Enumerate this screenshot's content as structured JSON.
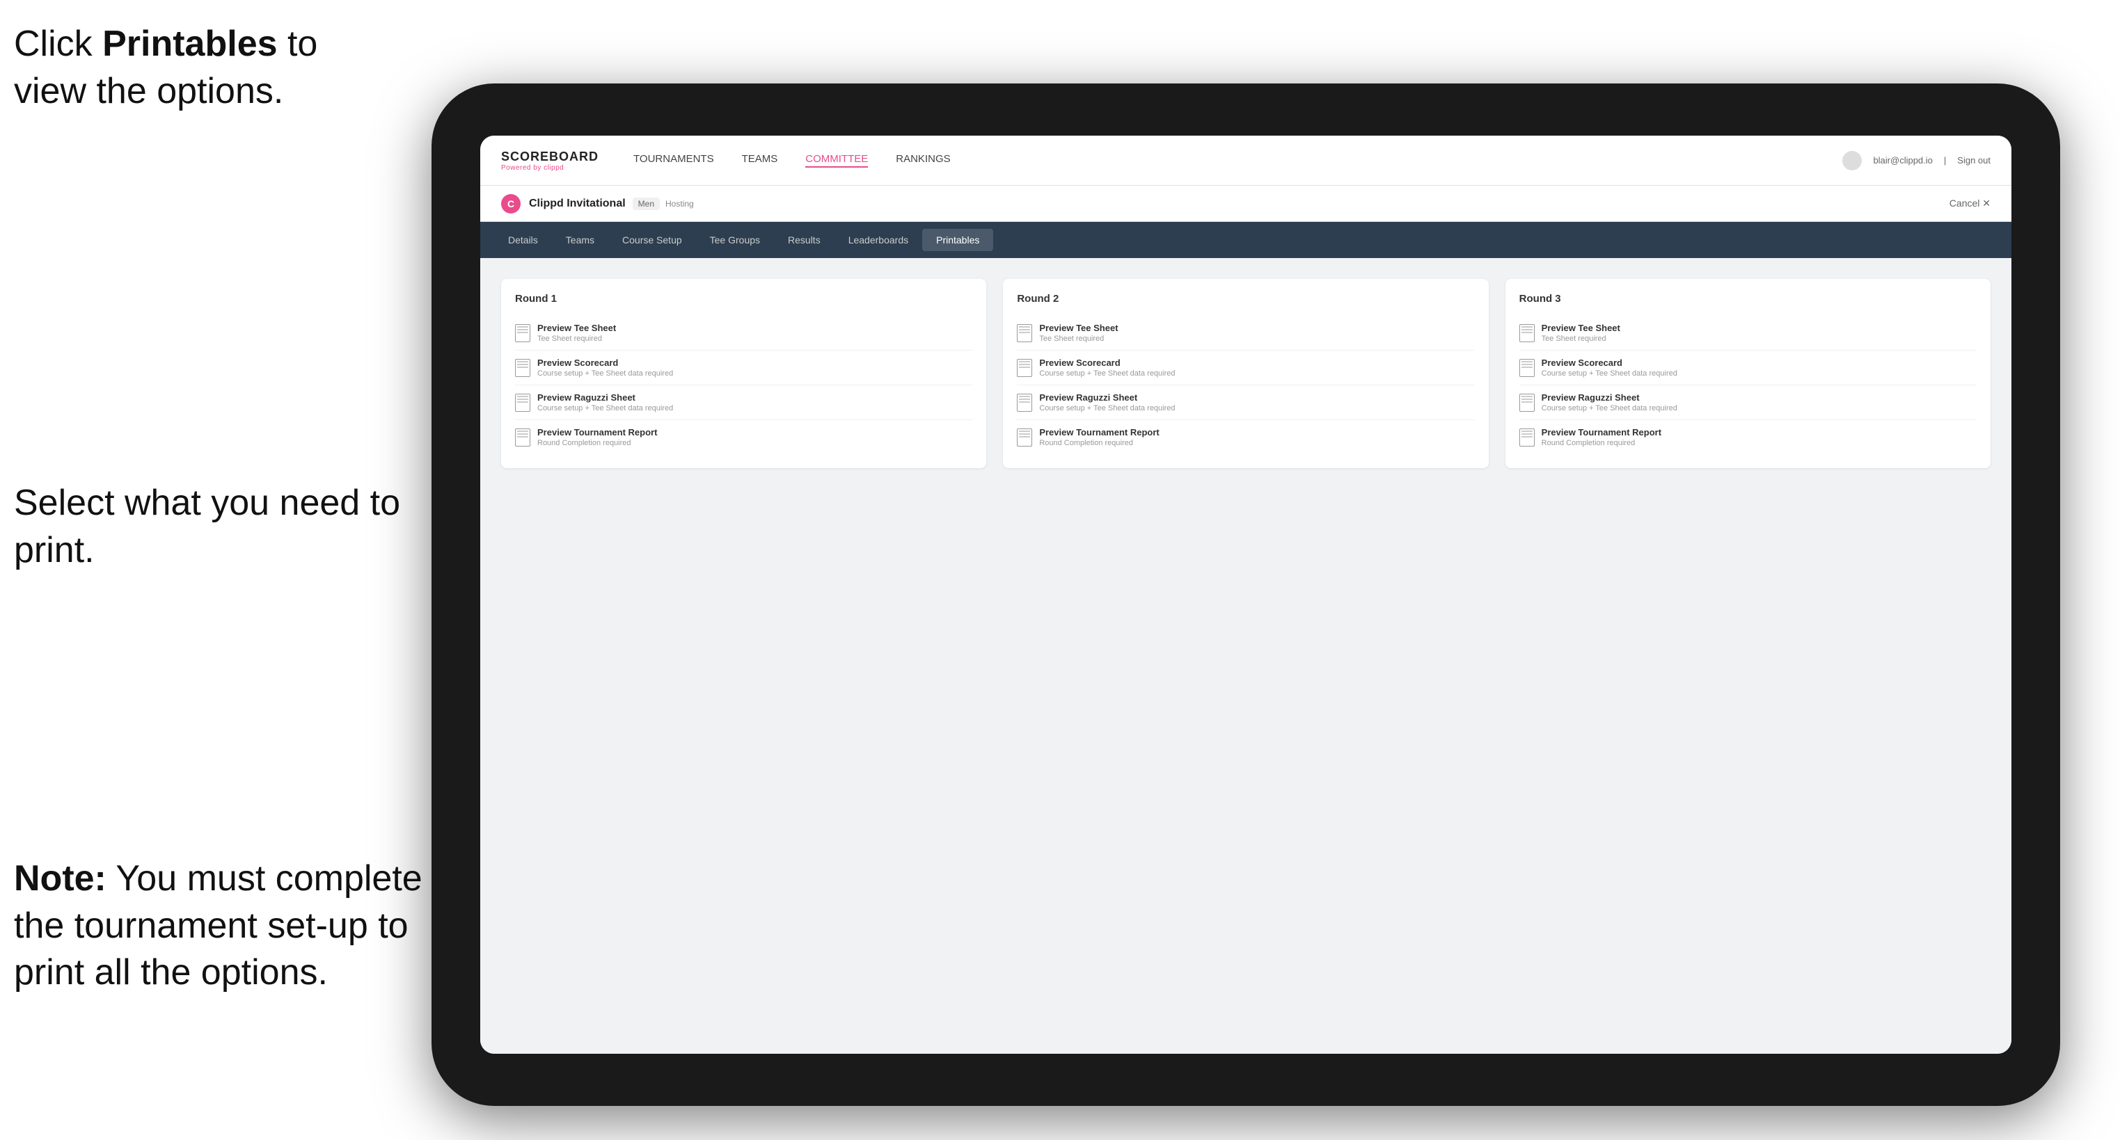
{
  "instructions": {
    "top": "Click ",
    "top_bold": "Printables",
    "top_suffix": " to view the options.",
    "middle": "Select what you need to print.",
    "bottom_bold": "Note:",
    "bottom_suffix": " You must complete the tournament set-up to print all the options."
  },
  "topnav": {
    "logo": "SCOREBOARD",
    "logo_sub": "Powered by clippd",
    "links": [
      "TOURNAMENTS",
      "TEAMS",
      "COMMITTEE",
      "RANKINGS"
    ],
    "user_email": "blair@clippd.io",
    "sign_out": "Sign out"
  },
  "subheader": {
    "logo_letter": "C",
    "tournament_name": "Clippd Invitational",
    "badge": "Men",
    "hosting": "Hosting",
    "cancel": "Cancel ✕"
  },
  "tabs": [
    "Details",
    "Teams",
    "Course Setup",
    "Tee Groups",
    "Results",
    "Leaderboards",
    "Printables"
  ],
  "active_tab": "Printables",
  "rounds": [
    {
      "title": "Round 1",
      "items": [
        {
          "label": "Preview Tee Sheet",
          "sublabel": "Tee Sheet required"
        },
        {
          "label": "Preview Scorecard",
          "sublabel": "Course setup + Tee Sheet data required"
        },
        {
          "label": "Preview Raguzzi Sheet",
          "sublabel": "Course setup + Tee Sheet data required"
        },
        {
          "label": "Preview Tournament Report",
          "sublabel": "Round Completion required"
        }
      ]
    },
    {
      "title": "Round 2",
      "items": [
        {
          "label": "Preview Tee Sheet",
          "sublabel": "Tee Sheet required"
        },
        {
          "label": "Preview Scorecard",
          "sublabel": "Course setup + Tee Sheet data required"
        },
        {
          "label": "Preview Raguzzi Sheet",
          "sublabel": "Course setup + Tee Sheet data required"
        },
        {
          "label": "Preview Tournament Report",
          "sublabel": "Round Completion required"
        }
      ]
    },
    {
      "title": "Round 3",
      "items": [
        {
          "label": "Preview Tee Sheet",
          "sublabel": "Tee Sheet required"
        },
        {
          "label": "Preview Scorecard",
          "sublabel": "Course setup + Tee Sheet data required"
        },
        {
          "label": "Preview Raguzzi Sheet",
          "sublabel": "Course setup + Tee Sheet data required"
        },
        {
          "label": "Preview Tournament Report",
          "sublabel": "Round Completion required"
        }
      ]
    }
  ]
}
